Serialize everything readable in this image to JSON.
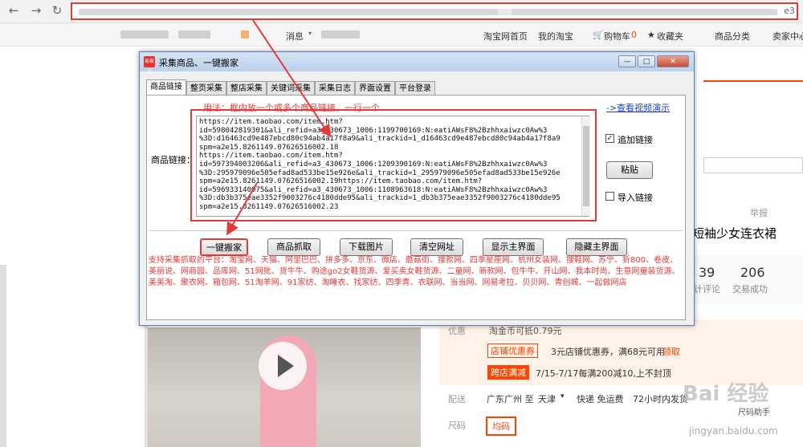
{
  "browser": {
    "back": "←",
    "forward": "→",
    "reload": "↻",
    "url_tail": "e3"
  },
  "topbar": {
    "message": "消息",
    "links": [
      "淘宝网首页",
      "我的淘宝",
      "购物车",
      "收藏夹",
      "商品分类",
      "卖家中心"
    ],
    "cart_count": "0"
  },
  "dialog": {
    "title": "采集商品、一键搬家",
    "logo_text": "易家电",
    "tabs": [
      "商品链接",
      "整页采集",
      "整店采集",
      "关键词采集",
      "采集日志",
      "界面设置",
      "平台登录"
    ],
    "usage_hint": "用法：框内放一个或多个商品链接，一行一个",
    "video_link": "->查看视频演示",
    "link_label": "商品链接：",
    "textarea_lines": [
      "https://item.taobao.com/item.htm?",
      "id=598042819301&ali_refid=a3_430673_1006:1199700169:N:eatiAWsF8%2Bzhhxaiwzc0Aw%3",
      "%3D:d16463cd9e487ebcd80c94ab4a17f8a9&ali_trackid=1_d16463cd9e487ebcd80c94ab4a17f8a9",
      "spm=a2e15.8261149.07626516002.18",
      "https://item.taobao.com/item.htm?",
      "id=597394003206&ali_refid=a3_430673_1006:1209390169:N:eatiAWsF8%2Bzhhxaiwzc0Aw%3",
      "%3D:295979096e505efad8ad533be15e926e&ali_trackid=1_295979096e505efad8ad533be15e926e",
      "spm=a2e15.8261149.07626516002.19https://item.taobao.com/item.htm?",
      "id=596933140075&ali_refid=a3_430673_1006:1108963618:N:eatiAWsF8%2Bzhhxaiwzc0Aw%3",
      "%3D:db3b375eae3352f9003276c4180dde95&ali_trackid=1_db3b375eae3352f9003276c4180dde95",
      "spm=a2e15.8261149.07626516002.23"
    ],
    "append_label": "追加链接",
    "paste_label": "粘贴",
    "import_label": "导入链接",
    "buttons": [
      "一键搬家",
      "商品抓取",
      "下载图片",
      "清空网址",
      "显示主界面",
      "隐藏主界面"
    ],
    "support_text": "支持采集抓取的平台：淘宝网、天猫、阿里巴巴、拼多多、京东、微店、蘑菇街、搜款网、四季星座网、杭州女装网、搜鞋网、苏宁、折800、卷皮、美丽说、网商园、品库网、51网批、货牛牛、购途go2女鞋货源、爱买卖女鞋货源、二童网、新款网、包牛牛、开山网、我本时尚、生意网童装货源、美美淘、聚衣网、箱包网、51淘羊网、91家纺、淘睡衣、找家纺、四季青、衣联网、当当网、网易考拉、贝贝网、青创城、一起做网店"
  },
  "product": {
    "report": "举报",
    "title_fragment": "短袖少女连衣裙",
    "reviews_num": "39",
    "reviews_label": "计评论",
    "sales_num": "206",
    "sales_label": "交易成功",
    "promo_label": "优惠",
    "promo_val": "淘金币可抵0.79元",
    "shop_coupon_tag": "店铺优惠券",
    "shop_coupon_text": "3元店铺优惠券，满68元可用",
    "receive": "领取",
    "cross_tag": "跨店满减",
    "cross_text": "7/15-7/17每满200减10,上不封顶",
    "ship_label": "配送",
    "ship_from": "广东广州 至",
    "ship_to": "天津",
    "ship_info": "快递 免运费",
    "ship_time": "72小时内发货",
    "size_label": "尺码",
    "size_option": "均码",
    "size_helper": "尺码助手"
  },
  "watermark": {
    "text": "Bai 经验",
    "url": "jingyan.baidu.com"
  },
  "colors": {
    "accent": "#f40",
    "annotation": "#e53a3a",
    "link": "#1a44c8"
  }
}
